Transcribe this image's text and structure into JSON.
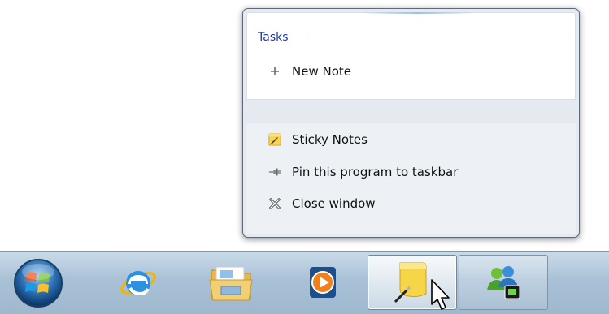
{
  "jumplist": {
    "section_header": "Tasks",
    "tasks": [
      {
        "label": "New Note",
        "icon": "plus-icon"
      }
    ],
    "program_items": [
      {
        "label": "Sticky Notes",
        "icon": "sticky-notes-icon"
      },
      {
        "label": "Pin this program to taskbar",
        "icon": "pin-icon"
      },
      {
        "label": "Close window",
        "icon": "close-window-icon"
      }
    ]
  },
  "taskbar": {
    "buttons": [
      {
        "name": "start-button",
        "icon": "windows-logo-icon"
      },
      {
        "name": "internet-explorer-button",
        "icon": "internet-explorer-icon"
      },
      {
        "name": "windows-explorer-button",
        "icon": "folder-icon"
      },
      {
        "name": "windows-media-player-button",
        "icon": "media-player-icon"
      },
      {
        "name": "sticky-notes-button",
        "icon": "sticky-notes-icon",
        "state": "active"
      },
      {
        "name": "live-messenger-button",
        "icon": "messenger-icon",
        "state": "running"
      }
    ]
  },
  "colors": {
    "header_blue": "#1e3a9a",
    "taskbar": "#a9c1d6",
    "jumplist_bg": "#e5eaf1"
  }
}
